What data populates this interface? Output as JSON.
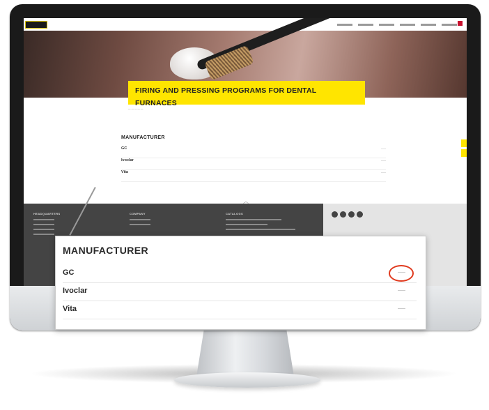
{
  "hero": {
    "title_line1": "FIRING AND PRESSING PROGRAMS FOR DENTAL",
    "title_line2": "FURNACES"
  },
  "manufacturers": {
    "heading": "MANUFACTURER",
    "items": [
      {
        "name": "GC"
      },
      {
        "name": "Ivoclar"
      },
      {
        "name": "Vita"
      }
    ]
  },
  "footer": {
    "col1": "HEADQUARTERS",
    "col2": "COMPANY",
    "col3": "CATALOGS"
  },
  "icons": [
    "brand-logo-icon",
    "language-flag-icon",
    "social-media-icons",
    "scroll-up-chevron-icon"
  ],
  "colors": {
    "accent": "#ffe500",
    "highlight_ring": "#e03a1e",
    "footer": "#444444"
  }
}
